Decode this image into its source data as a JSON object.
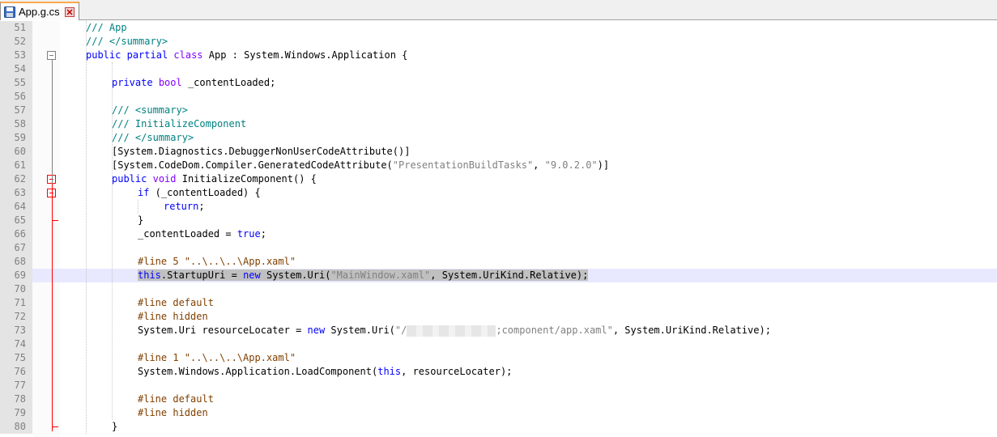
{
  "tab": {
    "title": "App.g.cs"
  },
  "lines": [
    {
      "num": "51",
      "text": "/// App"
    },
    {
      "num": "52",
      "text": "/// </summary>"
    },
    {
      "num": "53",
      "text": "public partial class App : System.Windows.Application {"
    },
    {
      "num": "54",
      "text": ""
    },
    {
      "num": "55",
      "text": "private bool _contentLoaded;"
    },
    {
      "num": "56",
      "text": ""
    },
    {
      "num": "57",
      "text": "/// <summary>"
    },
    {
      "num": "58",
      "text": "/// InitializeComponent"
    },
    {
      "num": "59",
      "text": "/// </summary>"
    },
    {
      "num": "60",
      "text": "[System.Diagnostics.DebuggerNonUserCodeAttribute()]"
    },
    {
      "num": "61",
      "text": "[System.CodeDom.Compiler.GeneratedCodeAttribute(\"PresentationBuildTasks\", \"9.0.2.0\")]"
    },
    {
      "num": "62",
      "text": "public void InitializeComponent() {"
    },
    {
      "num": "63",
      "text": "if (_contentLoaded) {"
    },
    {
      "num": "64",
      "text": "return;"
    },
    {
      "num": "65",
      "text": "}"
    },
    {
      "num": "66",
      "text": "_contentLoaded = true;"
    },
    {
      "num": "67",
      "text": ""
    },
    {
      "num": "68",
      "text": "#line 5 \"..\\..\\..\\App.xaml\""
    },
    {
      "num": "69",
      "text": "this.StartupUri = new System.Uri(\"MainWindow.xaml\", System.UriKind.Relative);"
    },
    {
      "num": "70",
      "text": ""
    },
    {
      "num": "71",
      "text": "#line default"
    },
    {
      "num": "72",
      "text": "#line hidden"
    },
    {
      "num": "73",
      "text": "System.Uri resourceLocater = new System.Uri(\"/;component/app.xaml\", System.UriKind.Relative);"
    },
    {
      "num": "74",
      "text": ""
    },
    {
      "num": "75",
      "text": "#line 1 \"..\\..\\..\\App.xaml\""
    },
    {
      "num": "76",
      "text": "System.Windows.Application.LoadComponent(this, resourceLocater);"
    },
    {
      "num": "77",
      "text": ""
    },
    {
      "num": "78",
      "text": "#line default"
    },
    {
      "num": "79",
      "text": "#line hidden"
    },
    {
      "num": "80",
      "text": "}"
    }
  ],
  "colors": {
    "keyword": "#0000ff",
    "type_keyword": "#8000ff",
    "comment": "#008080",
    "string": "#808080",
    "preprocessor": "#804000",
    "current_line": "#e8e8ff",
    "fold_marker_active": "#ff0000",
    "tab_accent": "#f9a94b"
  }
}
